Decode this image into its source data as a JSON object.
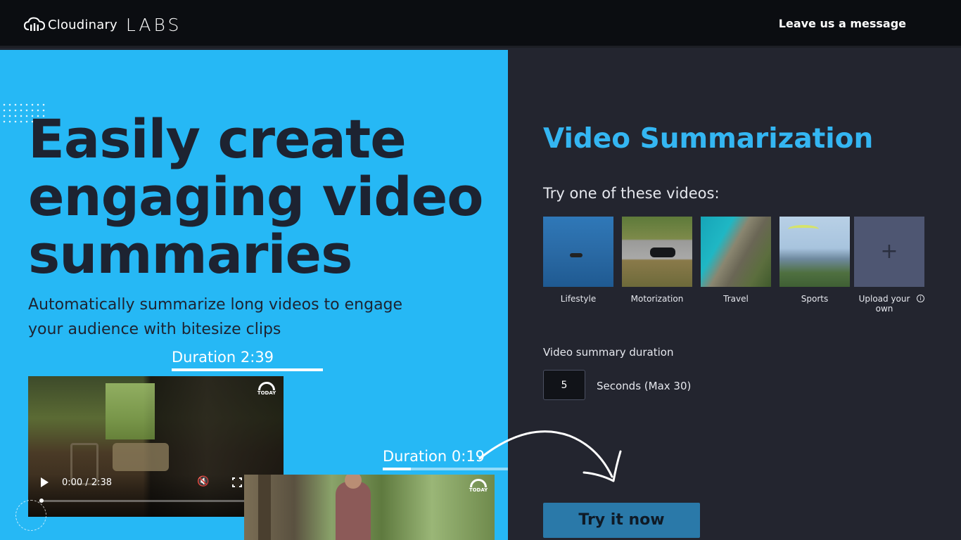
{
  "header": {
    "brand": "Cloudinary",
    "labs": "LABS",
    "leave_message": "Leave us a message"
  },
  "hero": {
    "title": "Easily create engaging video summaries",
    "subtitle": "Automatically summarize long videos to engage your audience with bitesize clips",
    "duration_original": "Duration 2:39",
    "duration_summary": "Duration 0:19",
    "video": {
      "time": "0:00 / 2:38",
      "badge": "TODAY"
    }
  },
  "panel": {
    "title": "Video Summarization",
    "try_label": "Try one of these videos:",
    "samples": [
      {
        "label": "Lifestyle"
      },
      {
        "label": "Motorization"
      },
      {
        "label": "Travel"
      },
      {
        "label": "Sports"
      }
    ],
    "upload_label": "Upload your own",
    "duration_label": "Video summary duration",
    "duration_value": "5",
    "duration_unit": "Seconds (Max 30)",
    "cta": "Try it now"
  },
  "colors": {
    "hero_bg": "#26b8f5",
    "panel_bg": "#23252f",
    "accent": "#34b6f2",
    "cta_bg": "#2a79a9",
    "topbar_bg": "#0b0d11"
  }
}
